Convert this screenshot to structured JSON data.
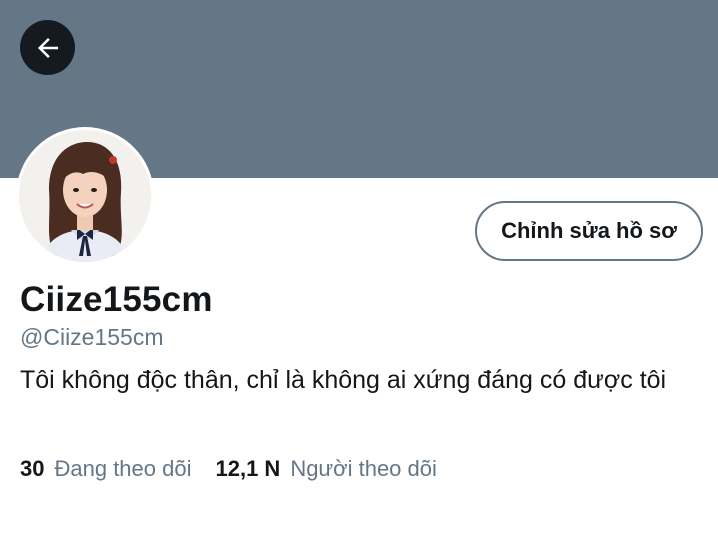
{
  "profile": {
    "display_name": "Ciize155cm",
    "handle": "@Ciize155cm",
    "bio": "Tôi không độc thân, chỉ là không ai xứng đáng có được tôi",
    "edit_button_label": "Chỉnh sửa hồ sơ"
  },
  "stats": {
    "following_count": "30",
    "following_label": "Đang theo dõi",
    "followers_count": "12,1 N",
    "followers_label": "Người theo dõi"
  },
  "icons": {
    "back": "arrow-left-icon"
  },
  "colors": {
    "banner": "#657786",
    "back_button": "#141a20",
    "secondary_text": "#657786",
    "primary_text": "#14171a"
  }
}
